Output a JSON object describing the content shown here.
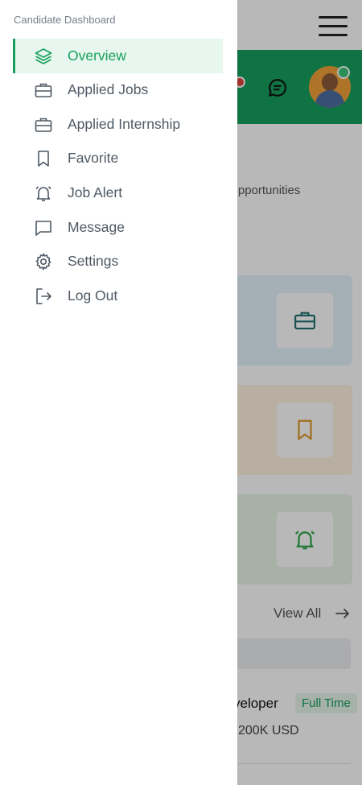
{
  "colors": {
    "accent": "#17a05d"
  },
  "drawer": {
    "title": "Candidate Dashboard",
    "items": [
      {
        "label": "Overview",
        "icon": "layers-icon",
        "active": true
      },
      {
        "label": "Applied Jobs",
        "icon": "briefcase-icon",
        "active": false
      },
      {
        "label": "Applied Internship",
        "icon": "briefcase-icon",
        "active": false
      },
      {
        "label": "Favorite",
        "icon": "bookmark-icon",
        "active": false
      },
      {
        "label": "Job Alert",
        "icon": "bell-icon",
        "active": false
      },
      {
        "label": "Message",
        "icon": "message-icon",
        "active": false
      },
      {
        "label": "Settings",
        "icon": "gear-icon",
        "active": false
      },
      {
        "label": "Log Out",
        "icon": "logout-icon",
        "active": false
      }
    ]
  },
  "background": {
    "subtitle_fragment": "er opportunities",
    "view_all": "View All",
    "job_title_fragment": "veloper",
    "job_type": "Full Time",
    "salary_fragment": "200K USD",
    "card_icons": [
      "briefcase-icon",
      "bookmark-icon",
      "bell-icon"
    ]
  }
}
